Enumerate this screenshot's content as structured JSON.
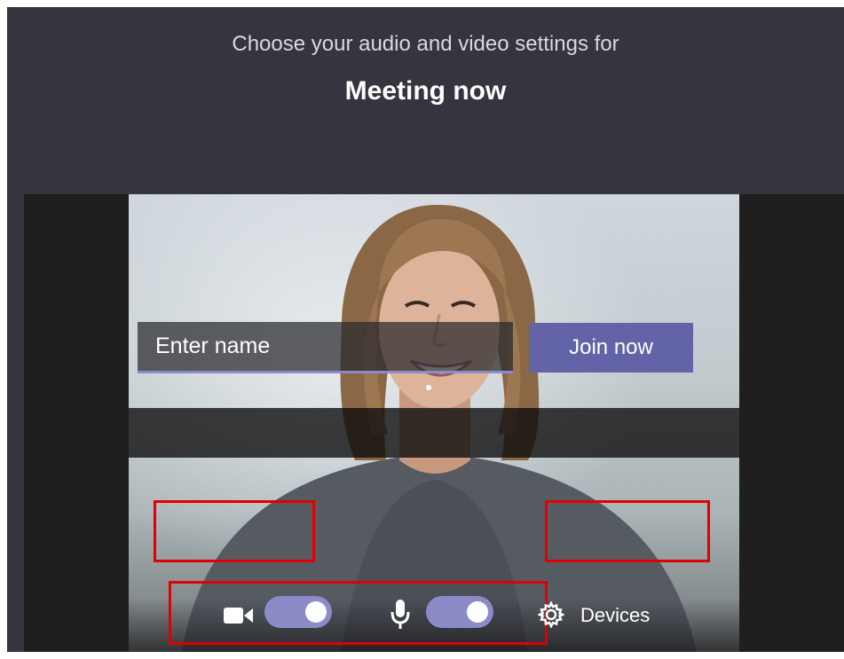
{
  "header": {
    "subtitle": "Choose your audio and video settings for",
    "title": "Meeting now"
  },
  "join_form": {
    "name_placeholder": "Enter name",
    "join_label": "Join now"
  },
  "controls": {
    "camera_on": true,
    "microphone_on": true,
    "devices_label": "Devices"
  },
  "colors": {
    "background": "#35343f",
    "accent": "#6264a7",
    "toggle_on": "#8b8cc7",
    "highlight_box": "#e00000"
  },
  "icons": [
    "camera-icon",
    "microphone-icon",
    "gear-icon"
  ]
}
